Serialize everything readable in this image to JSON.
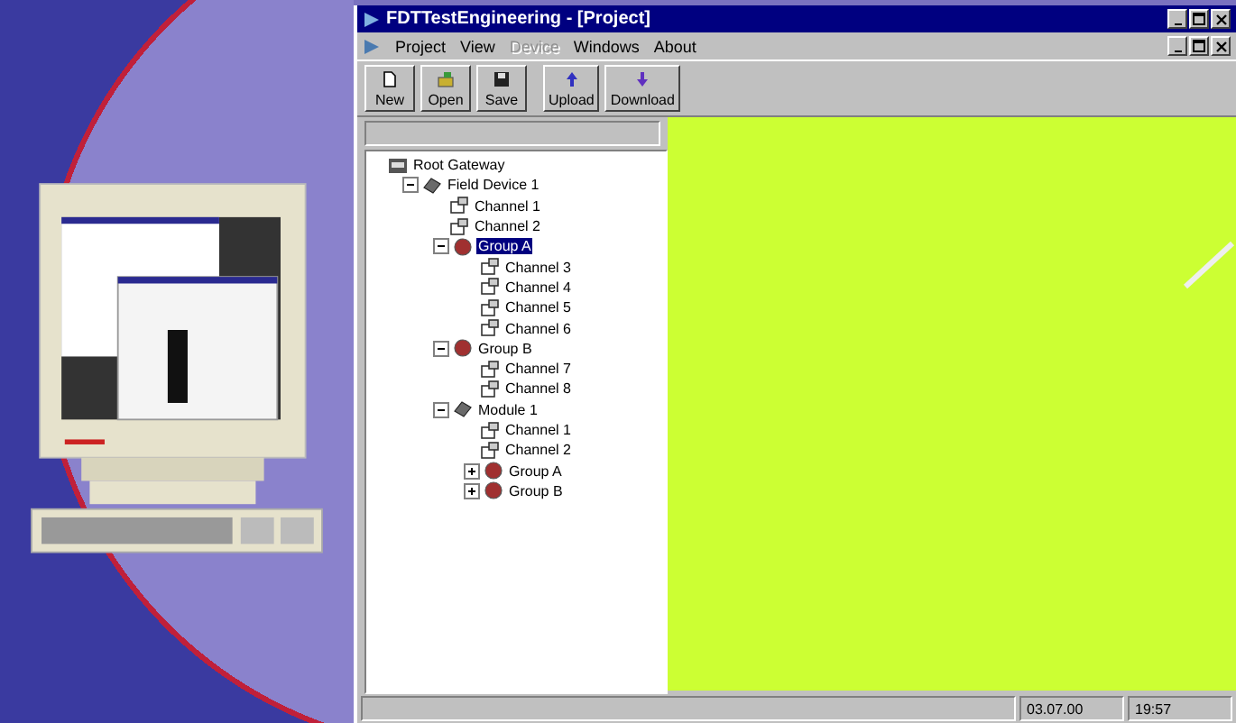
{
  "window": {
    "title": "FDTTestEngineering - [Project]"
  },
  "menu": [
    {
      "label": "Project",
      "disabled": false
    },
    {
      "label": "View",
      "disabled": false
    },
    {
      "label": "Device",
      "disabled": true
    },
    {
      "label": "Windows",
      "disabled": false
    },
    {
      "label": "About",
      "disabled": false
    }
  ],
  "toolbar": [
    {
      "label": "New",
      "kind": "new"
    },
    {
      "label": "Open",
      "kind": "open"
    },
    {
      "label": "Save",
      "kind": "save"
    },
    {
      "label": "Upload",
      "kind": "upload"
    },
    {
      "label": "Download",
      "kind": "download"
    }
  ],
  "tree": [
    {
      "label": "Root Gateway",
      "kind": "gateway",
      "selected": false,
      "children": [
        {
          "label": "Field Device 1",
          "kind": "device",
          "selected": false,
          "expanded": true,
          "children": [
            {
              "label": "Channel 1",
              "kind": "channel",
              "selected": false
            },
            {
              "label": "Channel 2",
              "kind": "channel",
              "selected": false
            },
            {
              "label": "Group A",
              "kind": "group",
              "selected": true,
              "expanded": true,
              "children": [
                {
                  "label": "Channel 3",
                  "kind": "channel",
                  "selected": false
                },
                {
                  "label": "Channel 4",
                  "kind": "channel",
                  "selected": false
                },
                {
                  "label": "Channel 5",
                  "kind": "channel",
                  "selected": false
                },
                {
                  "label": "Channel 6",
                  "kind": "channel",
                  "selected": false
                }
              ]
            },
            {
              "label": "Group B",
              "kind": "group",
              "selected": false,
              "expanded": true,
              "children": [
                {
                  "label": "Channel 7",
                  "kind": "channel",
                  "selected": false
                },
                {
                  "label": "Channel 8",
                  "kind": "channel",
                  "selected": false
                }
              ]
            },
            {
              "label": "Module 1",
              "kind": "device",
              "selected": false,
              "expanded": true,
              "children": [
                {
                  "label": "Channel 1",
                  "kind": "channel",
                  "selected": false
                },
                {
                  "label": "Channel 2",
                  "kind": "channel",
                  "selected": false
                },
                {
                  "label": "Group A",
                  "kind": "group",
                  "selected": false,
                  "expanded": false
                },
                {
                  "label": "Group B",
                  "kind": "group",
                  "selected": false,
                  "expanded": false
                }
              ]
            }
          ]
        }
      ]
    }
  ],
  "status_bar": {
    "date": "03.07.00",
    "time": "19:57"
  }
}
